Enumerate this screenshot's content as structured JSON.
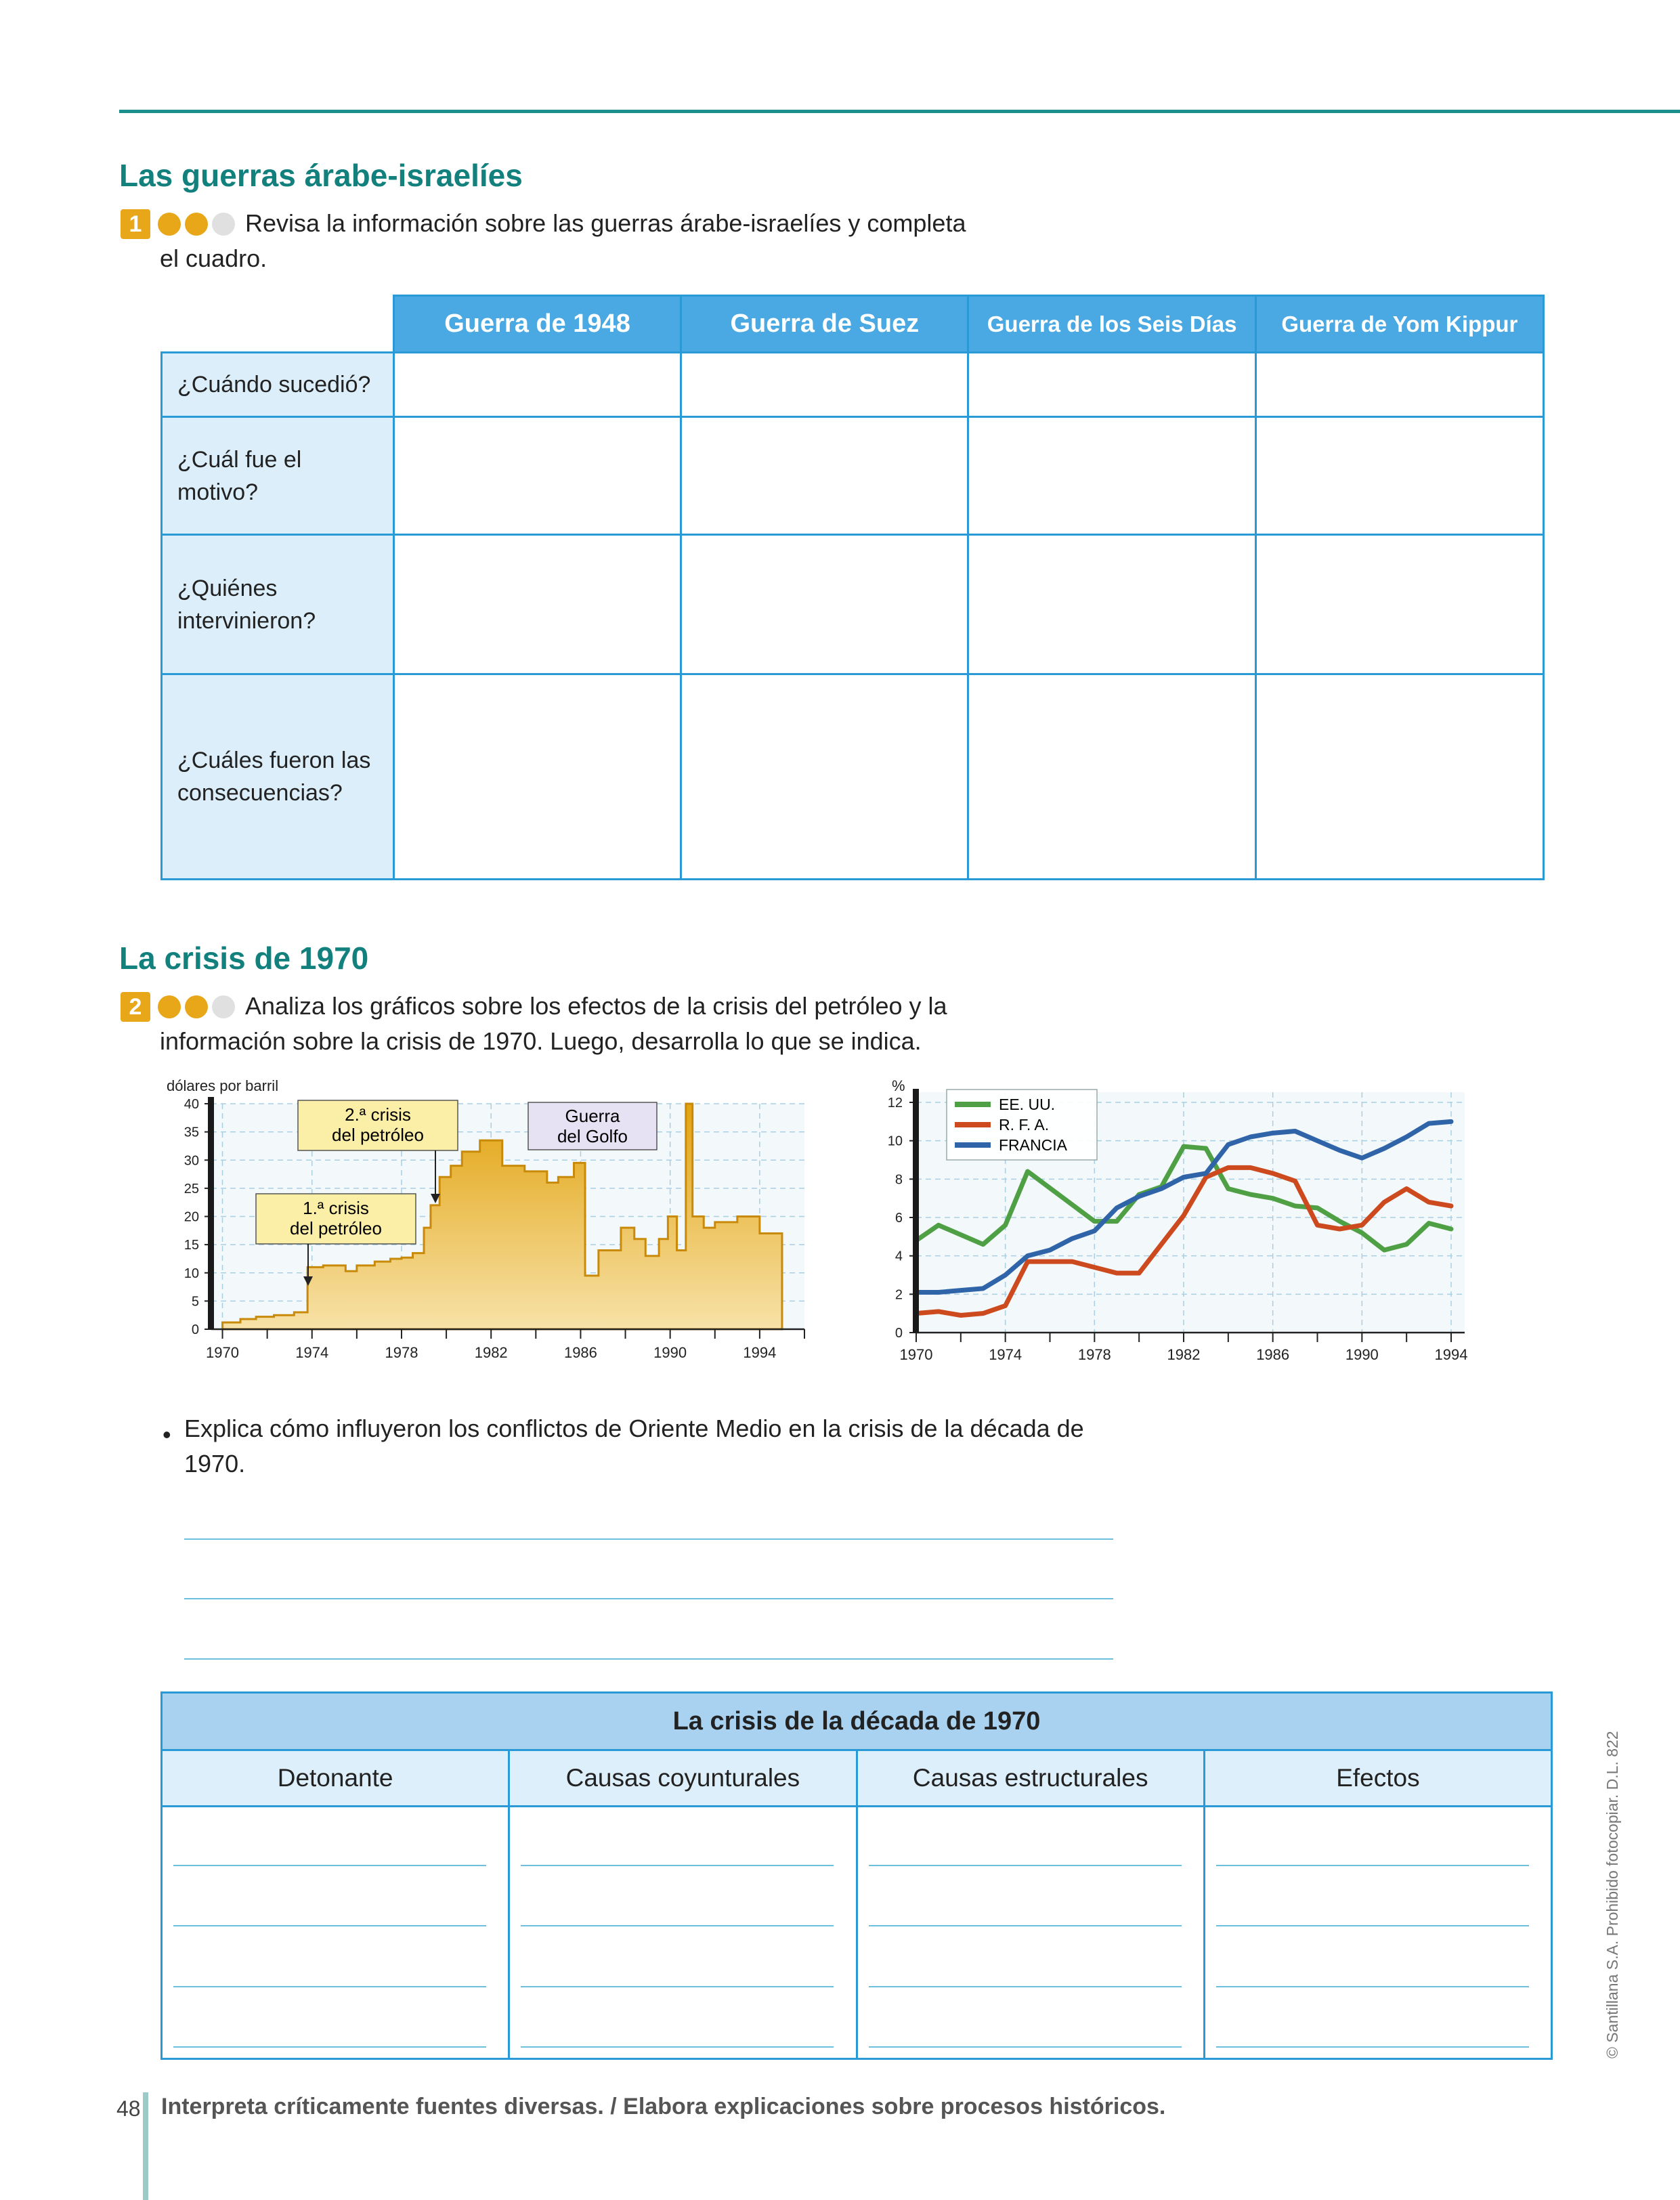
{
  "section1": {
    "title": "Las guerras árabe-israelíes",
    "activity_number": "1",
    "instruction_line1": "Revisa la información sobre las guerras árabe-israelíes y completa",
    "instruction_line2": "el cuadro.",
    "columns": [
      "Guerra de 1948",
      "Guerra de Suez",
      "Guerra de los Seis Días",
      "Guerra de Yom Kippur"
    ],
    "rows": [
      "¿Cuándo sucedió?",
      "¿Cuál fue el motivo?",
      "¿Quiénes intervinieron?",
      "¿Cuáles fueron las consecuencias?"
    ]
  },
  "section2": {
    "title": "La crisis de 1970",
    "activity_number": "2",
    "instruction_line1": "Analiza los gráficos sobre los efectos de la crisis del petróleo y la",
    "instruction_line2": "información sobre la crisis de 1970. Luego, desarrolla lo que se indica.",
    "bullet_line1": "Explica cómo influyeron los conflictos de Oriente Medio en la crisis de la década de",
    "bullet_line2": "1970."
  },
  "table2": {
    "title": "La crisis de la década de 1970",
    "columns": [
      "Detonante",
      "Causas coyunturales",
      "Causas estructurales",
      "Efectos"
    ]
  },
  "footer": {
    "page_number": "48",
    "text": "Interpreta críticamente fuentes diversas. / Elabora explicaciones sobre procesos históricos.",
    "copyright": "© Santillana S.A. Prohibido fotocopiar. D.L. 822"
  },
  "colors": {
    "accent": "#12807d",
    "table_border": "#2a9ad6",
    "header_fill": "#4aa8e2",
    "oil_fill": "#e8a619",
    "usa": "#4fa044",
    "rfa": "#cc4a1e",
    "francia": "#2f64a8"
  },
  "chart_data": [
    {
      "type": "area",
      "ylabel": "dólares por barril",
      "ylim": [
        0,
        40
      ],
      "yticks": [
        0,
        5,
        10,
        15,
        20,
        25,
        30,
        35,
        40
      ],
      "xticks": [
        1970,
        1974,
        1978,
        1982,
        1986,
        1990,
        1994
      ],
      "annotations": [
        {
          "line1": "1.ª crisis",
          "line2": "del petróleo"
        },
        {
          "line1": "2.ª crisis",
          "line2": "del petróleo"
        },
        {
          "line1": "Guerra",
          "line2": "del Golfo"
        }
      ],
      "series": [
        {
          "x": [
            1970,
            1970.8,
            1971.5,
            1972.3,
            1973.2,
            1973.8,
            1974.5,
            1975,
            1975.5,
            1976,
            1976.8,
            1977.5,
            1978,
            1978.5,
            1979,
            1979.3,
            1979.7,
            1980.2,
            1980.7,
            1981.5,
            1982.5,
            1983.5,
            1984.5,
            1985,
            1985.7,
            1986.2,
            1986.8,
            1987.8,
            1988.4,
            1988.9,
            1989.5,
            1989.9,
            1990.3,
            1990.7,
            1991,
            1991.5,
            1992,
            1993,
            1994,
            1995
          ],
          "values": [
            1.2,
            1.8,
            2.2,
            2.5,
            3,
            11,
            11.3,
            11.3,
            10.3,
            11.3,
            12,
            12.5,
            12.7,
            13.5,
            18,
            22,
            27,
            29,
            31.5,
            33.5,
            29,
            28,
            26,
            27,
            29.5,
            9.5,
            14,
            18,
            16,
            13,
            16,
            20,
            14,
            40,
            20,
            18,
            19,
            20,
            17,
            17
          ]
        }
      ]
    },
    {
      "type": "line",
      "ylabel": "%",
      "ylim": [
        0,
        12
      ],
      "yticks": [
        0,
        2,
        4,
        6,
        8,
        10,
        12
      ],
      "xticks": [
        1970,
        1974,
        1978,
        1982,
        1986,
        1990,
        1994
      ],
      "legend": "top-left",
      "series": [
        {
          "name": "EE. UU.",
          "color": "#4fa044",
          "x": [
            1970,
            1971,
            1973,
            1974,
            1975,
            1978,
            1979,
            1980,
            1981,
            1982,
            1983,
            1984,
            1985,
            1986,
            1987,
            1988,
            1989,
            1990,
            1991,
            1992,
            1993,
            1994
          ],
          "values": [
            4.8,
            5.6,
            4.6,
            5.6,
            8.4,
            5.8,
            5.8,
            7.2,
            7.6,
            9.7,
            9.6,
            7.5,
            7.2,
            7.0,
            6.6,
            6.5,
            5.8,
            5.2,
            4.3,
            4.6,
            5.7,
            5.4
          ]
        },
        {
          "name": "R. F. A.",
          "color": "#cc4a1e",
          "x": [
            1970,
            1971,
            1972,
            1973,
            1974,
            1975,
            1977,
            1978,
            1979,
            1980,
            1981,
            1982,
            1983,
            1984,
            1985,
            1986,
            1987,
            1988,
            1989,
            1990,
            1991,
            1992,
            1993,
            1994
          ],
          "values": [
            1.0,
            1.1,
            0.9,
            1.0,
            1.4,
            3.7,
            3.7,
            3.4,
            3.1,
            3.1,
            4.6,
            6.1,
            8.1,
            8.6,
            8.6,
            8.3,
            7.9,
            5.6,
            5.4,
            5.6,
            6.8,
            7.5,
            6.8,
            6.6
          ]
        },
        {
          "name": "FRANCIA",
          "color": "#2f64a8",
          "x": [
            1970,
            1971,
            1972,
            1973,
            1974,
            1975,
            1976,
            1977,
            1978,
            1979,
            1980,
            1981,
            1982,
            1983,
            1984,
            1985,
            1986,
            1987,
            1988,
            1989,
            1990,
            1991,
            1992,
            1993,
            1994
          ],
          "values": [
            2.1,
            2.1,
            2.2,
            2.3,
            3.0,
            4.0,
            4.3,
            4.9,
            5.3,
            6.5,
            7.1,
            7.5,
            8.1,
            8.3,
            9.8,
            10.2,
            10.4,
            10.5,
            10.0,
            9.5,
            9.1,
            9.6,
            10.2,
            10.9,
            11.0
          ]
        }
      ]
    }
  ]
}
